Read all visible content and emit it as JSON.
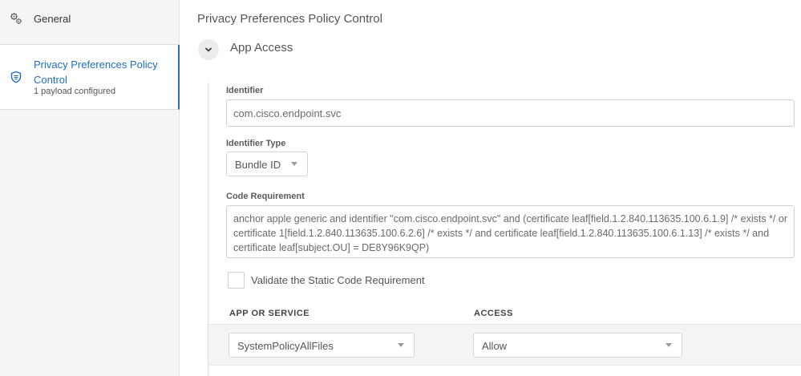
{
  "sidebar": {
    "items": [
      {
        "label": "General",
        "icon": "gears-icon"
      },
      {
        "label": "Privacy Preferences Policy Control",
        "sub": "1 payload configured",
        "icon": "shield-icon"
      }
    ]
  },
  "main": {
    "title": "Privacy Preferences Policy Control",
    "section": {
      "title": "App Access",
      "identifier": {
        "label": "Identifier",
        "value": "com.cisco.endpoint.svc"
      },
      "identifier_type": {
        "label": "Identifier Type",
        "value": "Bundle ID"
      },
      "code_requirement": {
        "label": "Code Requirement",
        "value": "anchor apple generic and identifier \"com.cisco.endpoint.svc\" and (certificate leaf[field.1.2.840.113635.100.6.1.9] /* exists */ or certificate 1[field.1.2.840.113635.100.6.2.6] /* exists */ and certificate leaf[field.1.2.840.113635.100.6.1.13] /* exists */ and certificate leaf[subject.OU] = DE8Y96K9QP)"
      },
      "validate_label": "Validate the Static Code Requirement",
      "validate_checked": false,
      "table": {
        "headers": [
          "APP OR SERVICE",
          "ACCESS"
        ],
        "rows": [
          {
            "service": "SystemPolicyAllFiles",
            "access": "Allow"
          }
        ]
      }
    }
  },
  "colors": {
    "accent": "#1f6fbf",
    "sidebar_bg": "#f5f5f5",
    "row_bg": "#f4f4f4"
  }
}
